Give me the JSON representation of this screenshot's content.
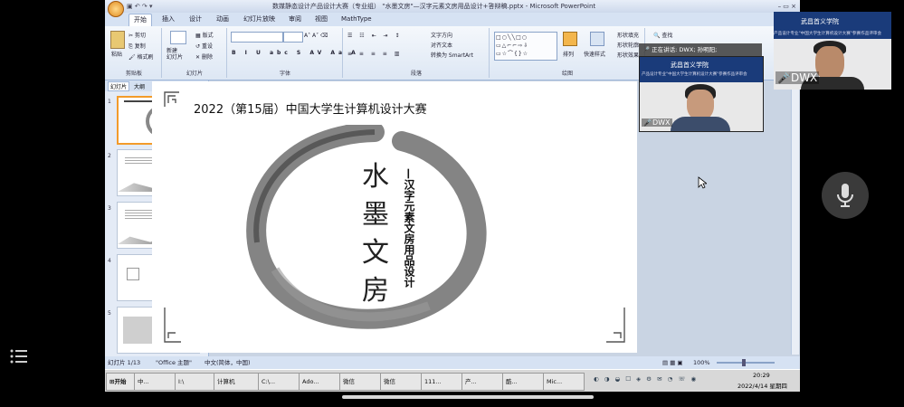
{
  "window_title": "数媒静态设计产品设计大赛（专业组） \"水墨文房\"—汉字元素文房用品设计+答辩稿.pptx - Microsoft PowerPoint",
  "ribbon_tabs": [
    "开始",
    "插入",
    "设计",
    "动画",
    "幻灯片放映",
    "审阅",
    "视图",
    "MathType"
  ],
  "ribbon": {
    "clipboard": {
      "paste": "粘贴",
      "cut": "剪切",
      "copy": "复制",
      "format_painter": "格式刷",
      "label": "剪贴板"
    },
    "slides": {
      "new_slide": "新建\n幻灯片",
      "layout": "版式",
      "reset": "重设",
      "delete": "删除",
      "label": "幻灯片"
    },
    "font_label": "字体",
    "paragraph": {
      "text_direction": "文字方向",
      "align_text": "对齐文本",
      "smartart": "转换为 SmartArt",
      "label": "段落"
    },
    "drawing": {
      "arrange": "排列",
      "quick_styles": "快速样式",
      "shape_fill": "形状填充",
      "shape_outline": "形状轮廓",
      "shape_effects": "形状效果",
      "label": "绘图"
    },
    "editing": {
      "find": "查找"
    }
  },
  "left_panel": {
    "tab_slides": "幻灯片",
    "tab_outline": "大纲",
    "close": "×"
  },
  "slide": {
    "heading": "2022（第15届）中国大学生计算机设计大赛",
    "vertical_title": [
      "水",
      "墨",
      "文",
      "房"
    ],
    "subtitle": "—汉字元素文房用品设计"
  },
  "status": {
    "slide_info": "幻灯片 1/13",
    "theme": "\"Office 主题\"",
    "language": "中文(简体，中国)",
    "zoom": "100%"
  },
  "taskbar": {
    "start": "开始",
    "items": [
      "中...",
      "I:\\",
      "计算机",
      "C:\\...",
      "Ado...",
      "微信",
      "微信",
      "111...",
      "产...",
      "酷...",
      "Mic..."
    ],
    "time": "20:29",
    "date": "2022/4/14 星期四"
  },
  "meeting": {
    "speaking_label": "正在讲话: DWX; 孙明阳;",
    "tile_name": "DWX",
    "self_name": "DWX",
    "school": "武昌首义学院",
    "banner": "产品设计专业\"中国大学生计算机设计大赛\"参赛作品评审会"
  },
  "colors": {
    "accent": "#2b5797",
    "bg": "#000000"
  }
}
